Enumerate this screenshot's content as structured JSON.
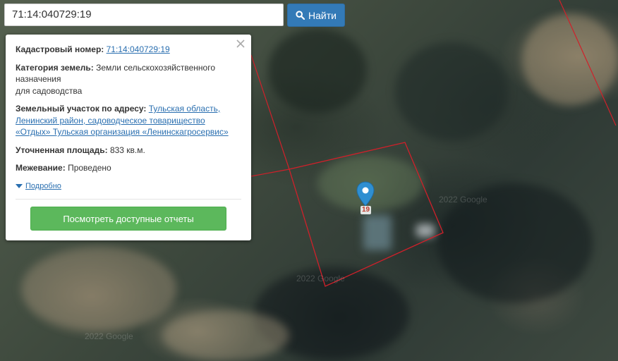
{
  "search": {
    "value": "71:14:040729:19",
    "button_label": "Найти"
  },
  "popup": {
    "cadastral_label": "Кадастровый номер:",
    "cadastral_value": "71:14:040729:19",
    "category_label": "Категория земель:",
    "category_value_line1": "Земли сельскохозяйственного",
    "category_value_line2": "назначения",
    "category_value_line3": "для садоводства",
    "address_label": "Земельный участок по адресу:",
    "address_line1": "Тульская область,",
    "address_line2": "Ленинский район, садоводческое товарищество",
    "address_line3": "«Отдых» Тульская организация «Ленинскагросервис»",
    "area_label": "Уточненная площадь:",
    "area_value": "833 кв.м.",
    "survey_label": "Межевание:",
    "survey_value": "Проведено",
    "more_label": "Подробно",
    "reports_button": "Посмотреть доступные отчеты"
  },
  "map": {
    "marker_label": "19",
    "watermark": "2022 Google",
    "boundary_color": "#d0202a",
    "marker_color": "#2f8fd1"
  }
}
